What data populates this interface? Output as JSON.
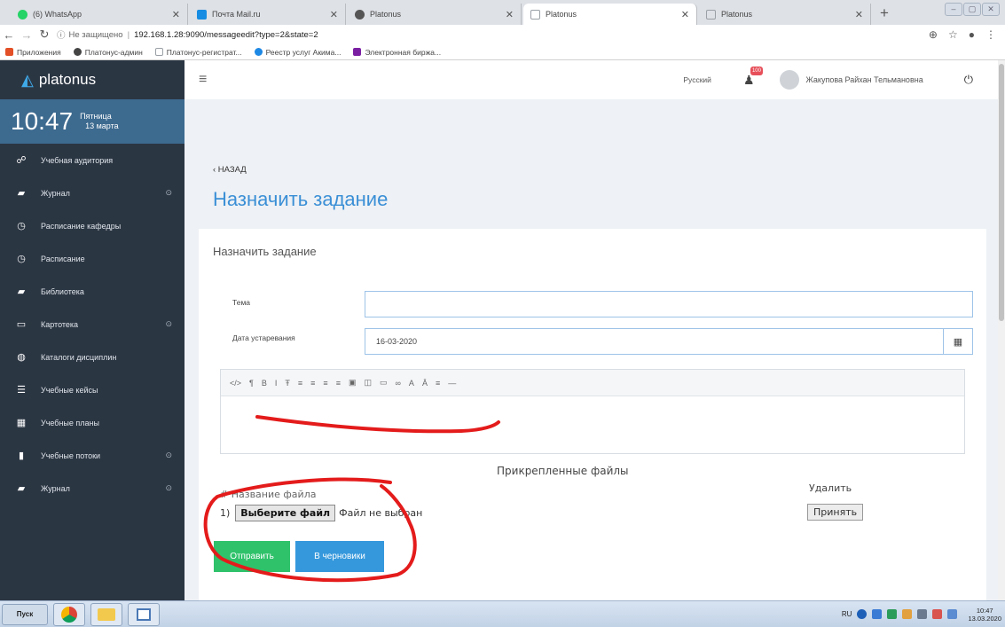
{
  "browser": {
    "tabs": [
      {
        "title": "(6) WhatsApp",
        "active": false,
        "icon_color": "#25d366"
      },
      {
        "title": "Почта Mail.ru",
        "active": false,
        "icon_color": "#168de2"
      },
      {
        "title": "Platonus",
        "active": false,
        "icon_color": "#555555"
      },
      {
        "title": "Platonus",
        "active": true,
        "icon_color": "#9aa0a6"
      },
      {
        "title": "Platonus",
        "active": false,
        "icon_color": "#9aa0a6"
      }
    ],
    "new_tab": "+",
    "address": {
      "insecure_label": "Не защищено",
      "url": "192.168.1.28:9090/messageedit?type=2&state=2"
    },
    "bookmarks": [
      {
        "label": "Приложения",
        "color": "#e34f26"
      },
      {
        "label": "Платонус-админ",
        "color": "#444444"
      },
      {
        "label": "Платонус-регистрат...",
        "color": "#9aa0a6"
      },
      {
        "label": "Реестр услуг Акима...",
        "color": "#1e88e5"
      },
      {
        "label": "Электронная биржа...",
        "color": "#7b1fa2"
      }
    ]
  },
  "sidebar": {
    "brand": "platonus",
    "clock": {
      "time": "10:47",
      "weekday": "Пятница",
      "date": "13 марта"
    },
    "items": [
      {
        "label": "Учебная аудитория",
        "icon": "users-icon",
        "glyph": "☍",
        "expandable": false
      },
      {
        "label": "Журнал",
        "icon": "book-icon",
        "glyph": "▰",
        "expandable": true
      },
      {
        "label": "Расписание кафедры",
        "icon": "clock-icon",
        "glyph": "◷",
        "expandable": false
      },
      {
        "label": "Расписание",
        "icon": "clock-icon",
        "glyph": "◷",
        "expandable": false
      },
      {
        "label": "Библиотека",
        "icon": "book-icon",
        "glyph": "▰",
        "expandable": false
      },
      {
        "label": "Картотека",
        "icon": "folder-icon",
        "glyph": "▭",
        "expandable": true
      },
      {
        "label": "Каталоги дисциплин",
        "icon": "catalog-icon",
        "glyph": "◍",
        "expandable": false
      },
      {
        "label": "Учебные кейсы",
        "icon": "list-icon",
        "glyph": "☰",
        "expandable": false
      },
      {
        "label": "Учебные планы",
        "icon": "grid-icon",
        "glyph": "▦",
        "expandable": false
      },
      {
        "label": "Учебные потоки",
        "icon": "file-icon",
        "glyph": "▮",
        "expandable": true
      },
      {
        "label": "Журнал",
        "icon": "book-icon",
        "glyph": "▰",
        "expandable": true
      }
    ],
    "expand_glyph": "⊙"
  },
  "topbar": {
    "language": "Русский",
    "notifications_count": "100",
    "user_name": "Жакупова Райхан Тельмановна"
  },
  "page": {
    "back_label": "‹ НАЗАД",
    "title": "Назначить задание",
    "card_title": "Назначить задание",
    "form": {
      "topic_label": "Тема",
      "topic_value": "",
      "due_label": "Дата устаревания",
      "due_value": "16-03-2020"
    },
    "editor_toolbar": [
      "</>",
      "¶",
      "B",
      "I",
      "Ŧ",
      "≡",
      "≡",
      "≡",
      "≡",
      "▣",
      "◫",
      "▭",
      "∞",
      "A",
      "Ā",
      "≡",
      "—"
    ],
    "files": {
      "title": "Прикрепленные файлы",
      "header_name": "# Название файла",
      "header_delete": "Удалить",
      "row_number": "1)",
      "choose_button": "Выберите файл",
      "no_file": "Файл не выбран",
      "accept_button": "Принять"
    },
    "buttons": {
      "send": "Отправить",
      "draft": "В черновики"
    }
  },
  "taskbar": {
    "start_label": "Пуск",
    "language": "RU",
    "time": "10:47",
    "date": "13.03.2020"
  },
  "colors": {
    "sidebar_bg": "#2b3643",
    "clock_bg": "#3d6a8f",
    "accent": "#3a8fd6",
    "send_button": "#2fc26b",
    "draft_button": "#3598dc",
    "annotation": "#e41b1b"
  }
}
